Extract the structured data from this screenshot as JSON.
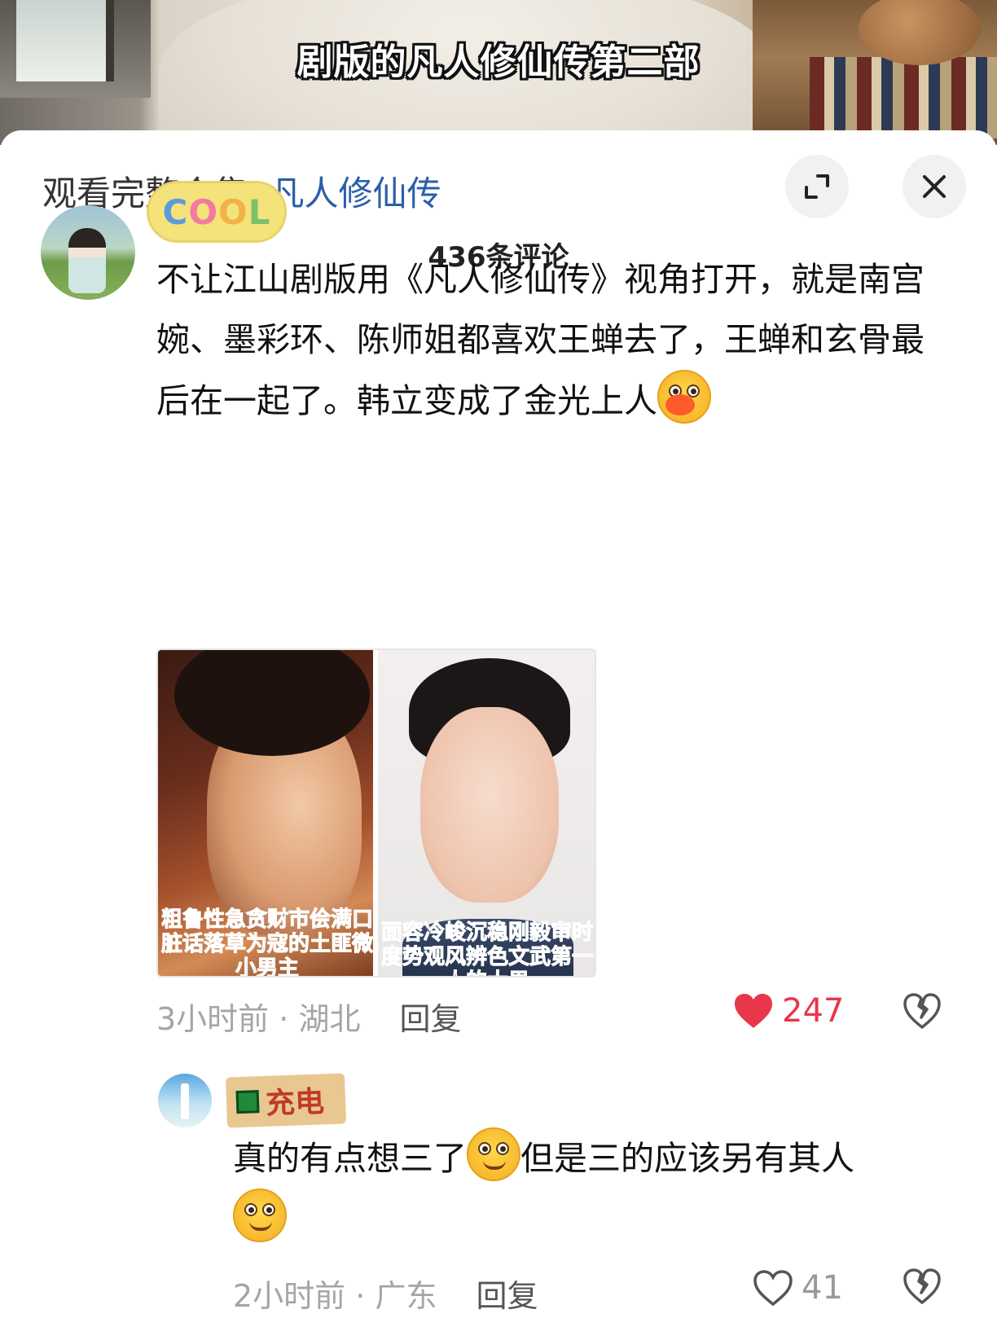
{
  "video": {
    "caption": "剧版的凡人修仙传第二部"
  },
  "sheet": {
    "header_prefix": "观看完整合集: ",
    "header_link": "凡人修仙传",
    "comment_count": "436条评论",
    "icons": {
      "expand": "expand-icon",
      "close": "close-icon"
    }
  },
  "comments": [
    {
      "badge": "COOL",
      "text_parts": [
        "不让江山剧版用《凡人修仙传》视角打开，就是南宫婉、墨彩环、陈师姐都喜欢王蝉去了，王蝉和玄骨最后在一起了。韩立变成了金光上人"
      ],
      "emoji": "kiss-emoji",
      "images": {
        "left_caption": "粗鲁性急贪财市侩满口脏话落草为寇的土匪微小男主",
        "right_caption": "面容冷峻沉稳刚毅审时度势观风辨色文武第一人的大男"
      },
      "time": "3小时前",
      "location": "湖北",
      "reply_label": "回复",
      "likes": "247",
      "liked": true,
      "accent_color": "#e8364a"
    },
    {
      "badge": "充电",
      "text_before": "真的有点想三了",
      "text_middle": "但是三的应该另有其人",
      "emoji": "smile-emoji",
      "time": "2小时前",
      "location": "广东",
      "reply_label": "回复",
      "likes": "41",
      "liked": false
    }
  ]
}
